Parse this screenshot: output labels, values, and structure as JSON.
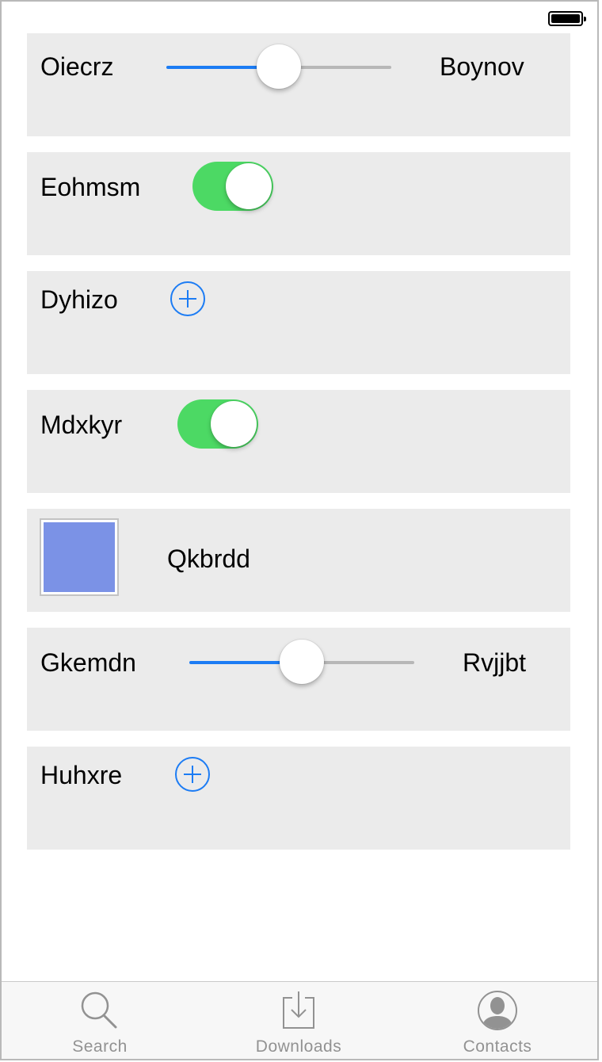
{
  "rows": [
    {
      "type": "slider",
      "label": "Oiecrz",
      "value_label": "Boynov",
      "value": 0.5
    },
    {
      "type": "toggle",
      "label": "Eohmsm",
      "on": true
    },
    {
      "type": "add",
      "label": "Dyhizo"
    },
    {
      "type": "toggle",
      "label": "Mdxkyr",
      "on": true
    },
    {
      "type": "swatch",
      "label": "Qkbrdd",
      "swatch_color": "#7b92e6"
    },
    {
      "type": "slider",
      "label": "Gkemdn",
      "value_label": "Rvjjbt",
      "value": 0.5
    },
    {
      "type": "add",
      "label": "Huhxre"
    }
  ],
  "tabs": [
    {
      "label": "Search",
      "icon": "search-icon"
    },
    {
      "label": "Downloads",
      "icon": "download-icon"
    },
    {
      "label": "Contacts",
      "icon": "contacts-icon"
    }
  ],
  "colors": {
    "accent": "#1c7cf4",
    "toggle_on": "#4cd964",
    "row_background": "#ebebeb",
    "tab_inactive": "#929292"
  }
}
